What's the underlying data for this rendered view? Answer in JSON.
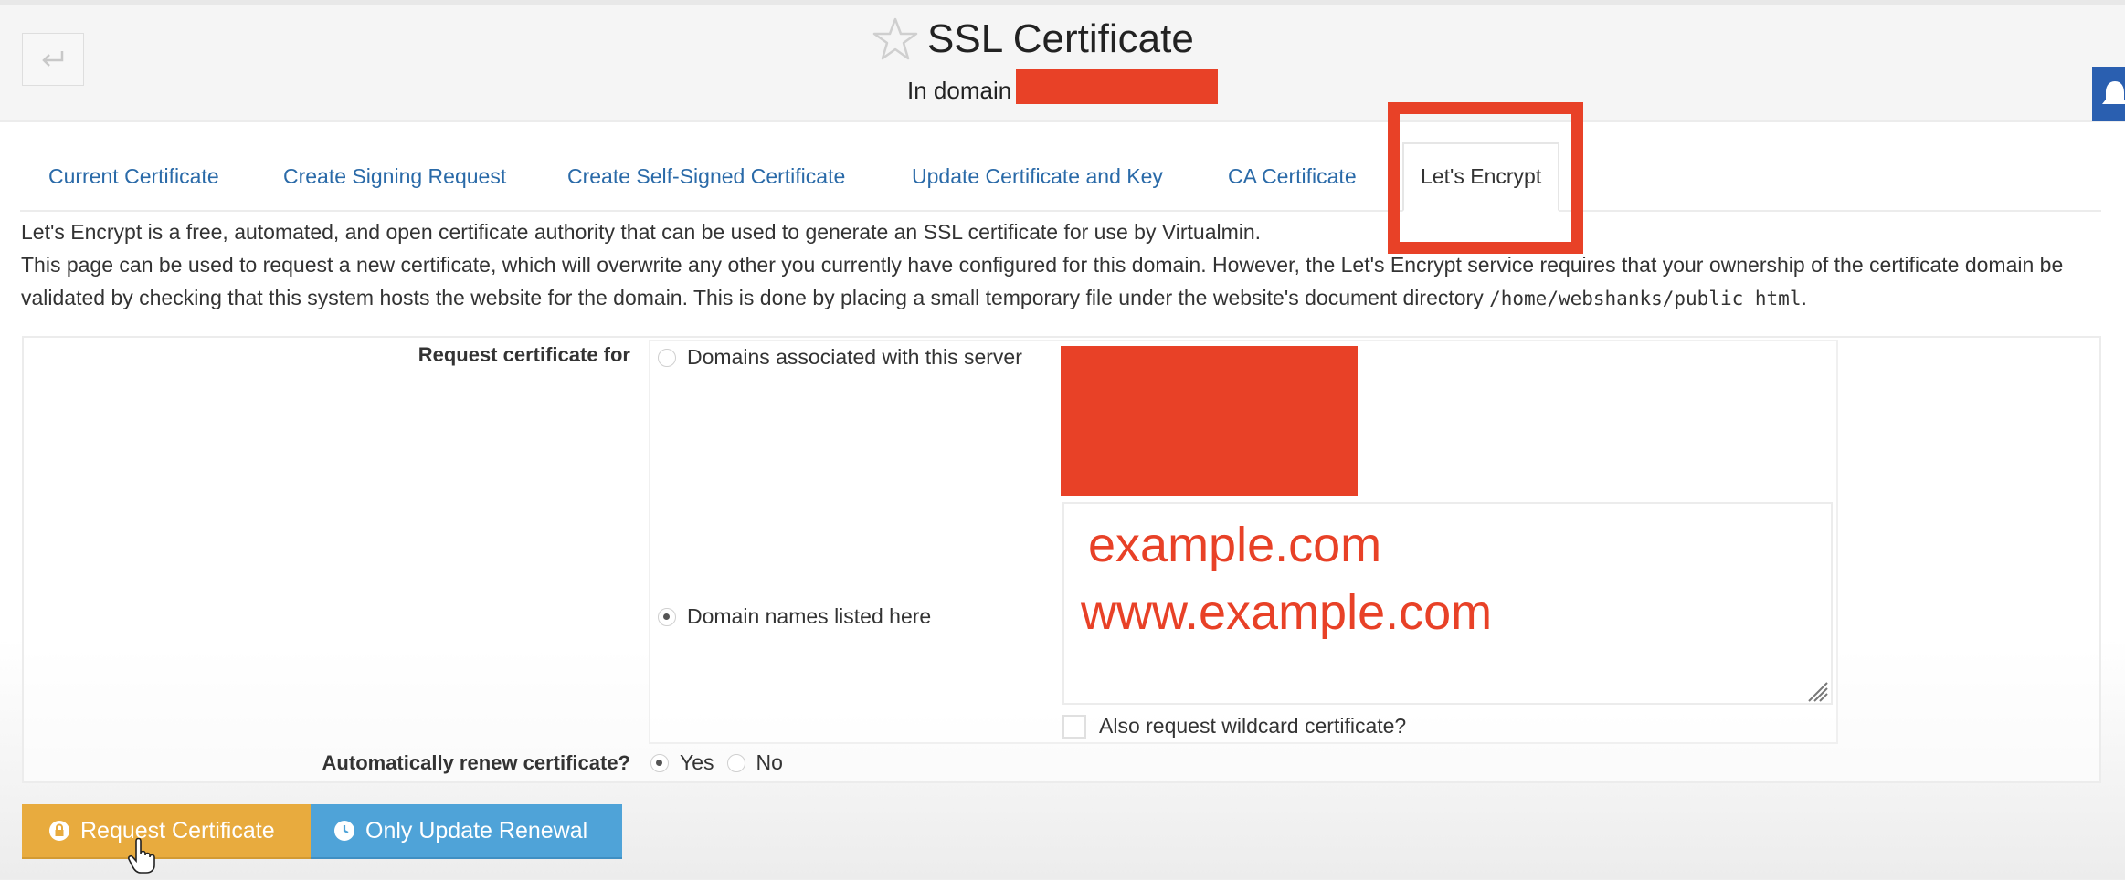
{
  "header": {
    "title": "SSL Certificate",
    "subtitle_prefix": "In domain",
    "back_icon": "return-arrow-icon",
    "star_icon": "star-outline-icon",
    "notification_icon": "bell-icon"
  },
  "tabs": [
    {
      "label": "Current Certificate",
      "active": false
    },
    {
      "label": "Create Signing Request",
      "active": false
    },
    {
      "label": "Create Self-Signed Certificate",
      "active": false
    },
    {
      "label": "Update Certificate and Key",
      "active": false
    },
    {
      "label": "CA Certificate",
      "active": false
    },
    {
      "label": "Let's Encrypt",
      "active": true
    }
  ],
  "description": {
    "line1": "Let's Encrypt is a free, automated, and open certificate authority that can be used to generate an SSL certificate for use by Virtualmin.",
    "line2": "This page can be used to request a new certificate, which will overwrite any other you currently have configured for this domain. However, the Let's Encrypt service requires that your ownership of the certificate domain be validated by checking that this system hosts the website for the domain. This is done by placing a small temporary file under the website's document directory",
    "path": "/home/webshanks/public_html",
    "path_suffix": "."
  },
  "form": {
    "request_for_label": "Request certificate for",
    "option_server_domains": {
      "label": "Domains associated with this server",
      "selected": false
    },
    "option_listed_domains": {
      "label": "Domain names listed here",
      "selected": true
    },
    "domains_textarea_lines": [
      "example.com",
      "www.example.com"
    ],
    "wildcard_checkbox": {
      "label": "Also request wildcard certificate?",
      "checked": false
    },
    "auto_renew_label": "Automatically renew certificate?",
    "auto_renew_options": [
      {
        "label": "Yes",
        "selected": true
      },
      {
        "label": "No",
        "selected": false
      }
    ]
  },
  "buttons": {
    "request": {
      "label": "Request Certificate",
      "icon": "lock-gear-icon"
    },
    "update_renewal": {
      "label": "Only Update Renewal",
      "icon": "gear-clock-icon"
    }
  },
  "colors": {
    "annotation_red": "#e84127",
    "tab_link": "#2a6aa8",
    "request_button": "#e8ab3e",
    "renewal_button": "#4fa3d8",
    "notification_widget": "#2a5fb0"
  }
}
